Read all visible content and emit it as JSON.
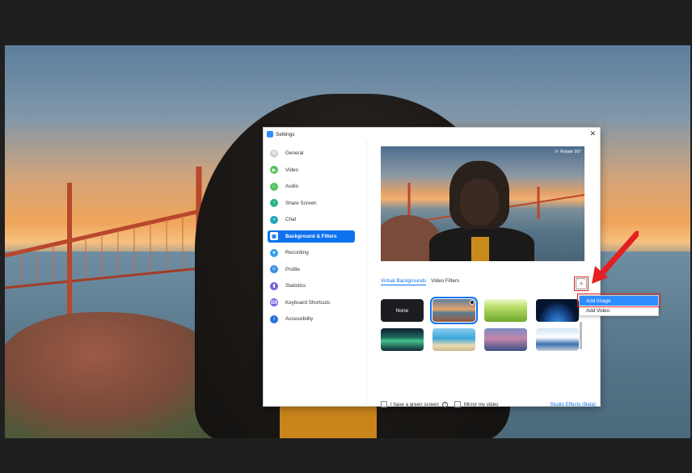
{
  "window": {
    "title": "Settings",
    "close_icon": "close-icon"
  },
  "sidebar": {
    "items": [
      {
        "label": "General",
        "icon": "gear-icon",
        "color": "#d0d0d0"
      },
      {
        "label": "Video",
        "icon": "video-icon",
        "color": "#55c35a"
      },
      {
        "label": "Audio",
        "icon": "headphones-icon",
        "color": "#55c35a"
      },
      {
        "label": "Share Screen",
        "icon": "share-screen-icon",
        "color": "#2db38a"
      },
      {
        "label": "Chat",
        "icon": "chat-icon",
        "color": "#21a7b8"
      },
      {
        "label": "Background & Filters",
        "icon": "background-icon",
        "color": "#0e72ed",
        "active": true
      },
      {
        "label": "Recording",
        "icon": "record-icon",
        "color": "#3aa0e8"
      },
      {
        "label": "Profile",
        "icon": "profile-icon",
        "color": "#3a8ee8"
      },
      {
        "label": "Statistics",
        "icon": "statistics-icon",
        "color": "#7b5be0"
      },
      {
        "label": "Keyboard Shortcuts",
        "icon": "keyboard-icon",
        "color": "#7b5be0"
      },
      {
        "label": "Accessibility",
        "icon": "accessibility-icon",
        "color": "#2d6fe0"
      }
    ]
  },
  "preview": {
    "rotate_label": "Rotate 90°"
  },
  "tabs": [
    {
      "label": "Virtual Backgrounds",
      "active": true
    },
    {
      "label": "Video Filters",
      "active": false
    }
  ],
  "backgrounds": [
    {
      "label": "None",
      "kind": "none"
    },
    {
      "label": "Golden Gate Bridge",
      "kind": "bridge",
      "selected": true
    },
    {
      "label": "Grass",
      "kind": "grass"
    },
    {
      "label": "Earth",
      "kind": "earth"
    },
    {
      "label": "Aurora",
      "kind": "aurora"
    },
    {
      "label": "Beach",
      "kind": "beach"
    },
    {
      "label": "Eiffel Tower",
      "kind": "eiffel"
    },
    {
      "label": "Train",
      "kind": "train"
    }
  ],
  "add_menu": {
    "items": [
      "Add Image",
      "Add Video"
    ]
  },
  "bottom": {
    "green_screen_label": "I have a green screen",
    "mirror_label": "Mirror my video",
    "studio_label": "Studio Effects (Beta)"
  },
  "colors": {
    "accent": "#0e72ed",
    "highlight": "#e52020"
  }
}
